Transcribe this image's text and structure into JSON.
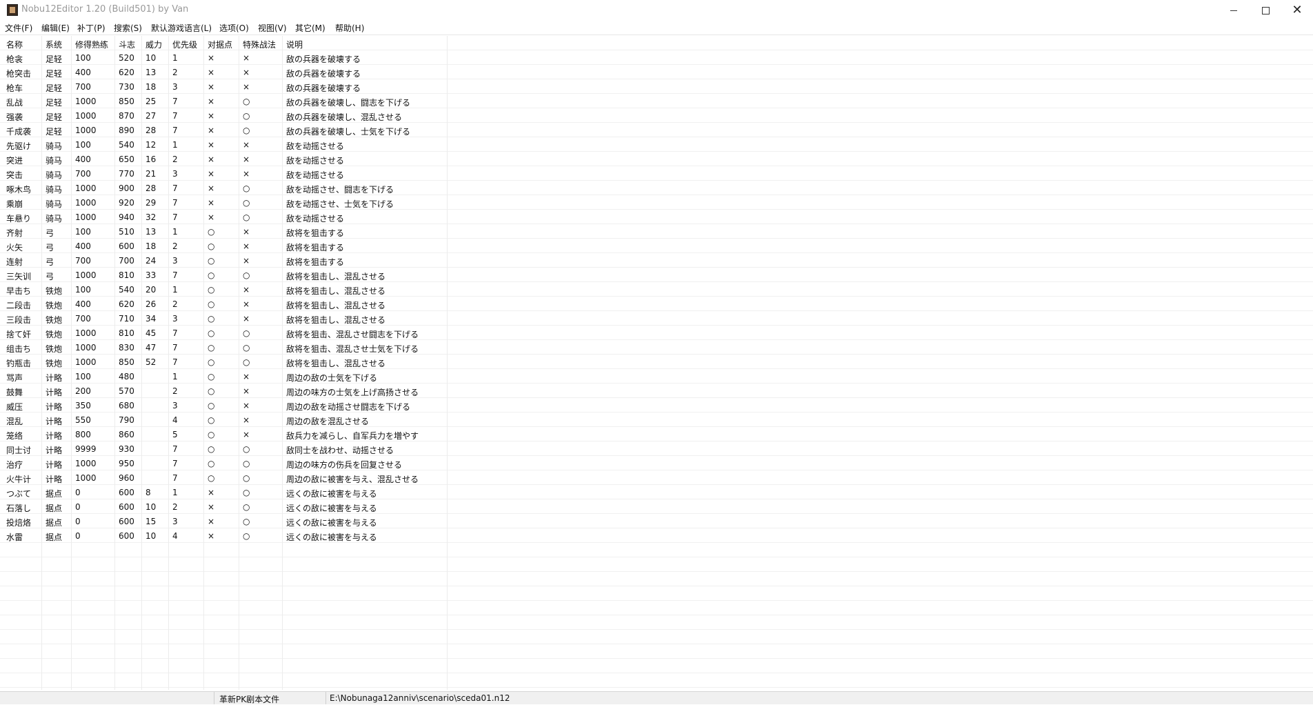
{
  "window": {
    "title": "Nobu12Editor 1.20 (Build501) by Van",
    "min_icon": "minimize-icon",
    "max_icon": "maximize-icon",
    "close_icon": "close-icon",
    "close_glyph": "✕"
  },
  "menu": [
    "文件(F)",
    "编辑(E)",
    "补丁(P)",
    "搜索(S)",
    "默认游戏语言(L)",
    "选项(O)",
    "视图(V)",
    "其它(M)",
    "帮助(H)"
  ],
  "table": {
    "columns": [
      "名称",
      "系统",
      "修得熟练",
      "斗志",
      "威力",
      "优先级",
      "对据点",
      "特殊战法",
      "说明"
    ],
    "rows": [
      [
        "枪衾",
        "足轻",
        "100",
        "520",
        "10",
        "1",
        "×",
        "×",
        "敌の兵器を破壊する"
      ],
      [
        "枪突击",
        "足轻",
        "400",
        "620",
        "13",
        "2",
        "×",
        "×",
        "敌の兵器を破壊する"
      ],
      [
        "枪车",
        "足轻",
        "700",
        "730",
        "18",
        "3",
        "×",
        "×",
        "敌の兵器を破壊する"
      ],
      [
        "乱战",
        "足轻",
        "1000",
        "850",
        "25",
        "7",
        "×",
        "○",
        "敌の兵器を破壊し、闘志を下げる"
      ],
      [
        "强袭",
        "足轻",
        "1000",
        "870",
        "27",
        "7",
        "×",
        "○",
        "敌の兵器を破壊し、混乱させる"
      ],
      [
        "千成袭",
        "足轻",
        "1000",
        "890",
        "28",
        "7",
        "×",
        "○",
        "敌の兵器を破壊し、士気を下げる"
      ],
      [
        "先驱け",
        "骑马",
        "100",
        "540",
        "12",
        "1",
        "×",
        "×",
        "敌を动摇させる"
      ],
      [
        "突进",
        "骑马",
        "400",
        "650",
        "16",
        "2",
        "×",
        "×",
        "敌を动摇させる"
      ],
      [
        "突击",
        "骑马",
        "700",
        "770",
        "21",
        "3",
        "×",
        "×",
        "敌を动摇させる"
      ],
      [
        "啄木鸟",
        "骑马",
        "1000",
        "900",
        "28",
        "7",
        "×",
        "○",
        "敌を动摇させ、闘志を下げる"
      ],
      [
        "乘崩",
        "骑马",
        "1000",
        "920",
        "29",
        "7",
        "×",
        "○",
        "敌を动摇させ、士気を下げる"
      ],
      [
        "车悬り",
        "骑马",
        "1000",
        "940",
        "32",
        "7",
        "×",
        "○",
        "敌を动摇させる"
      ],
      [
        "齐射",
        "弓",
        "100",
        "510",
        "13",
        "1",
        "○",
        "×",
        "敌将を狙击する"
      ],
      [
        "火矢",
        "弓",
        "400",
        "600",
        "18",
        "2",
        "○",
        "×",
        "敌将を狙击する"
      ],
      [
        "连射",
        "弓",
        "700",
        "700",
        "24",
        "3",
        "○",
        "×",
        "敌将を狙击する"
      ],
      [
        "三矢训",
        "弓",
        "1000",
        "810",
        "33",
        "7",
        "○",
        "○",
        "敌将を狙击し、混乱させる"
      ],
      [
        "早击ち",
        "铁炮",
        "100",
        "540",
        "20",
        "1",
        "○",
        "×",
        "敌将を狙击し、混乱させる"
      ],
      [
        "二段击",
        "铁炮",
        "400",
        "620",
        "26",
        "2",
        "○",
        "×",
        "敌将を狙击し、混乱させる"
      ],
      [
        "三段击",
        "铁炮",
        "700",
        "710",
        "34",
        "3",
        "○",
        "×",
        "敌将を狙击し、混乱させる"
      ],
      [
        "捨て奸",
        "铁炮",
        "1000",
        "810",
        "45",
        "7",
        "○",
        "○",
        "敌将を狙击、混乱させ闘志を下げる"
      ],
      [
        "组击ち",
        "铁炮",
        "1000",
        "830",
        "47",
        "7",
        "○",
        "○",
        "敌将を狙击、混乱させ士気を下げる"
      ],
      [
        "钓瓶击",
        "铁炮",
        "1000",
        "850",
        "52",
        "7",
        "○",
        "○",
        "敌将を狙击し、混乱させる"
      ],
      [
        "骂声",
        "计略",
        "100",
        "480",
        "",
        "1",
        "○",
        "×",
        "周边の敌の士気を下げる"
      ],
      [
        "鼓舞",
        "计略",
        "200",
        "570",
        "",
        "2",
        "○",
        "×",
        "周边の味方の士気を上げ高扬させる"
      ],
      [
        "威压",
        "计略",
        "350",
        "680",
        "",
        "3",
        "○",
        "×",
        "周边の敌を动摇させ闘志を下げる"
      ],
      [
        "混乱",
        "计略",
        "550",
        "790",
        "",
        "4",
        "○",
        "×",
        "周边の敌を混乱させる"
      ],
      [
        "笼络",
        "计略",
        "800",
        "860",
        "",
        "5",
        "○",
        "×",
        "敌兵力を减らし、自军兵力を増やす"
      ],
      [
        "同士讨",
        "计略",
        "9999",
        "930",
        "",
        "7",
        "○",
        "○",
        "敌同士を战わせ、动摇させる"
      ],
      [
        "治疗",
        "计略",
        "1000",
        "950",
        "",
        "7",
        "○",
        "○",
        "周边の味方の伤兵を回复させる"
      ],
      [
        "火牛计",
        "计略",
        "1000",
        "960",
        "",
        "7",
        "○",
        "○",
        "周边の敌に被害を与え、混乱させる"
      ],
      [
        "つぶて",
        "据点",
        "0",
        "600",
        "8",
        "1",
        "×",
        "○",
        "远くの敌に被害を与える"
      ],
      [
        "石落し",
        "据点",
        "0",
        "600",
        "10",
        "2",
        "×",
        "○",
        "远くの敌に被害を与える"
      ],
      [
        "投焙烙",
        "据点",
        "0",
        "600",
        "15",
        "3",
        "×",
        "○",
        "远くの敌に被害を与える"
      ],
      [
        "水雷",
        "据点",
        "0",
        "600",
        "10",
        "4",
        "×",
        "○",
        "远くの敌に被害を与える"
      ]
    ]
  },
  "status": {
    "file_type": "革新PK剧本文件",
    "path": "E:\\Nobunaga12anniv\\scenario\\sceda01.n12"
  }
}
